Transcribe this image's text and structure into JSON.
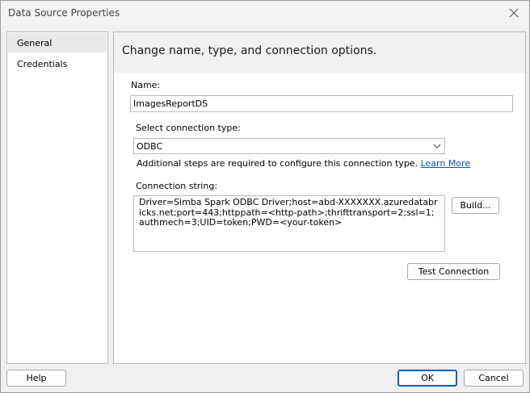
{
  "window": {
    "title": "Data Source Properties"
  },
  "sidebar": {
    "items": [
      {
        "label": "General",
        "selected": true
      },
      {
        "label": "Credentials",
        "selected": false
      }
    ]
  },
  "content": {
    "header": "Change name, type, and connection options.",
    "name_label": "Name:",
    "name_value": "ImagesReportDS",
    "conn_type_label": "Select connection type:",
    "conn_type_value": "ODBC",
    "hint_text": "Additional steps are required to configure this connection type.",
    "learn_more": "Learn More",
    "conn_string_label": "Connection string:",
    "conn_string_value": "Driver=Simba Spark ODBC Driver;host=abd-XXXXXXX.azuredatabricks.net;port=443;httppath=<http-path>;thrifttransport=2;ssl=1;authmech=3;UID=token;PWD=<your-token>",
    "build_button": "Build...",
    "test_connection_button": "Test Connection"
  },
  "footer": {
    "help_button": "Help",
    "ok_button": "OK",
    "cancel_button": "Cancel"
  }
}
